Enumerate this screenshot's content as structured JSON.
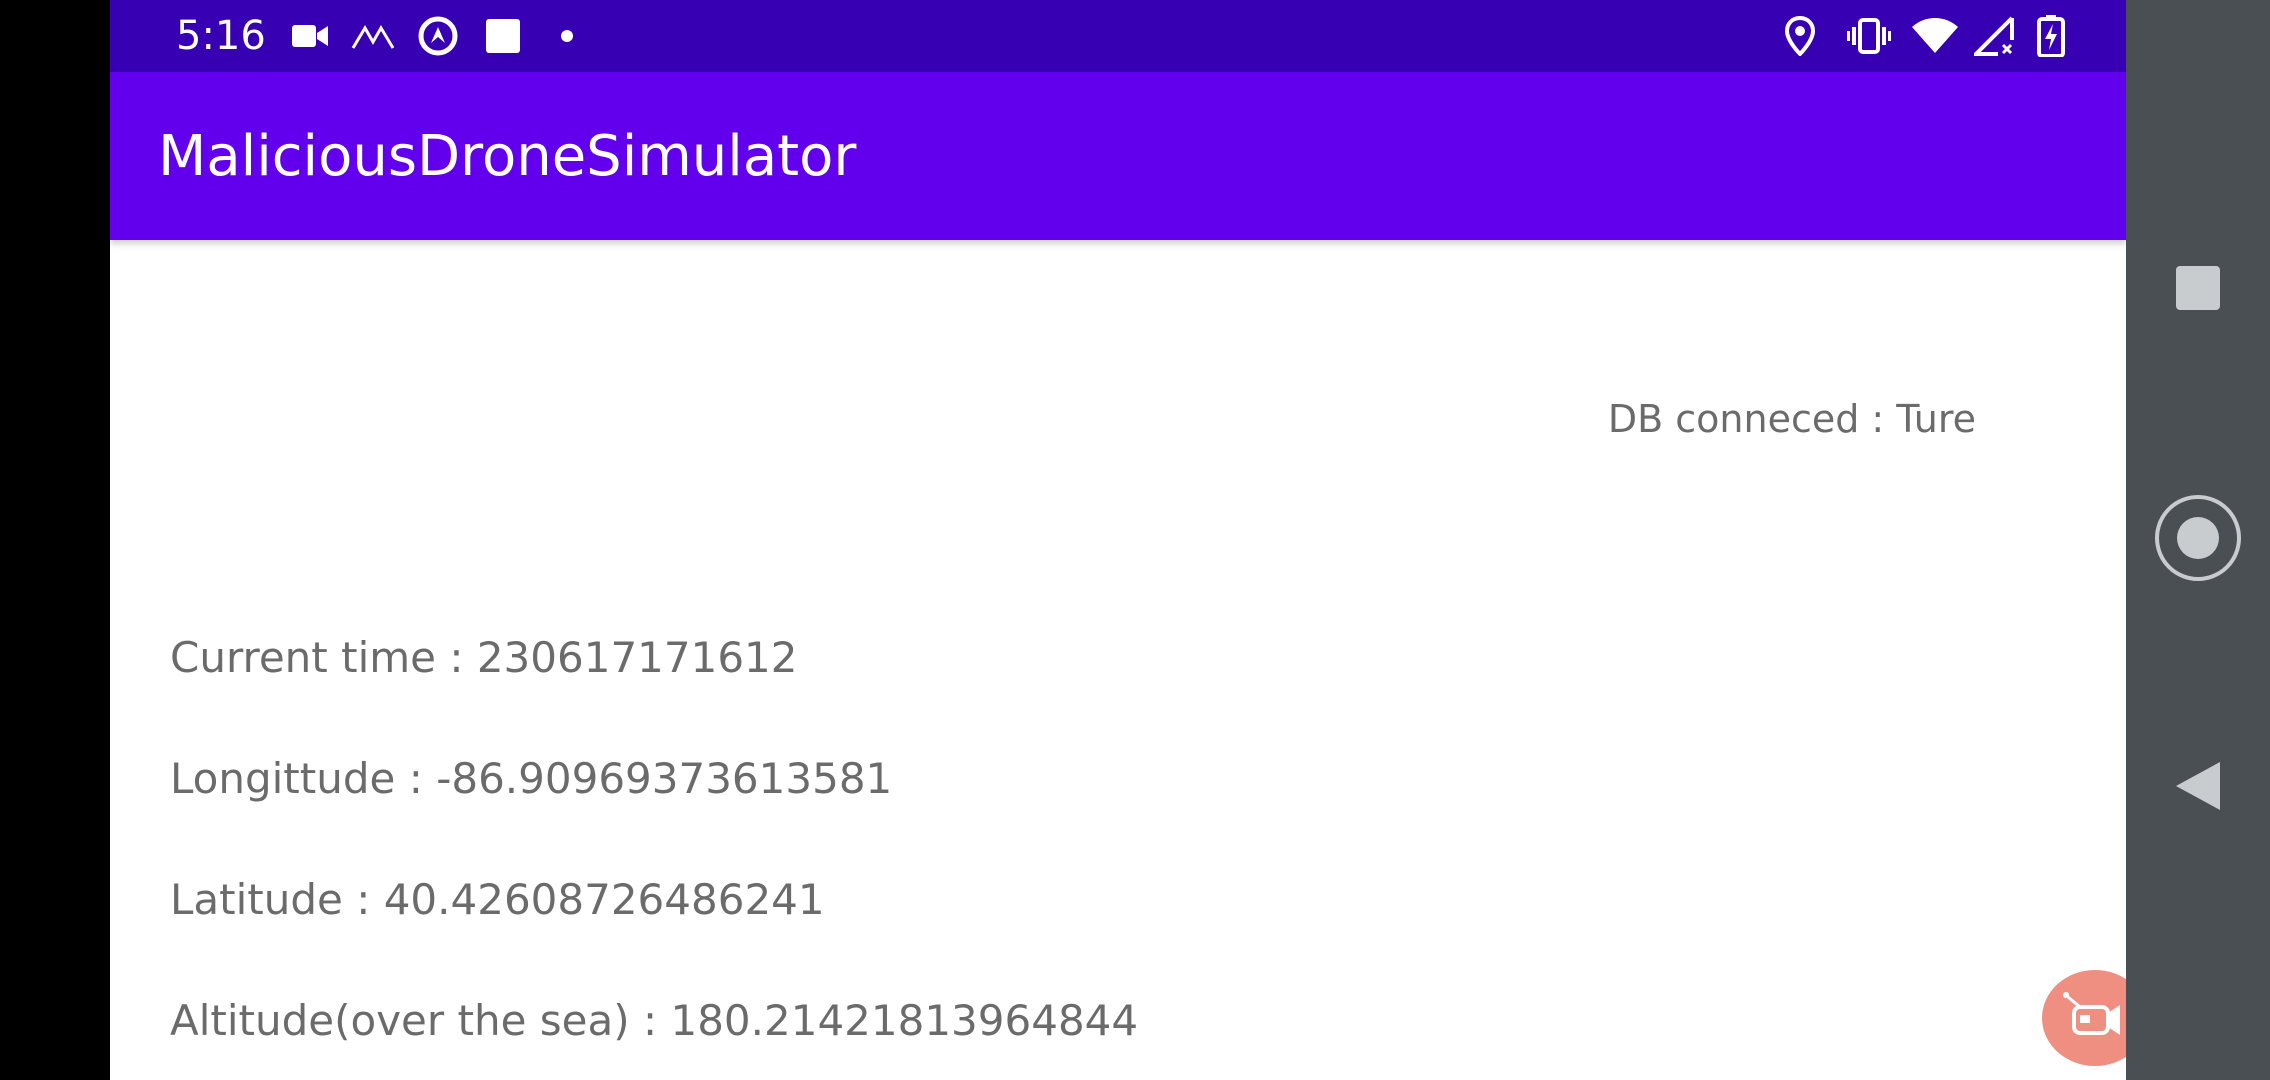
{
  "status_bar": {
    "time": "5:16",
    "left_icons": [
      "video-camera-icon",
      "signal-wave-icon",
      "vpn-circle-icon",
      "square-notification-icon",
      "dot-icon"
    ],
    "right_icons": [
      "location-icon",
      "vibrate-icon",
      "wifi-icon",
      "cellular-no-signal-icon",
      "battery-charging-icon"
    ]
  },
  "app_bar": {
    "title": "MaliciousDroneSimulator"
  },
  "content": {
    "db_status": "DB conneced : Ture",
    "current_time": "Current time : 230617171612",
    "longitude": "Longittude : -86.90969373613581",
    "latitude": "Latitude : 40.42608726486241",
    "altitude": "Altitude(over the sea) : 180.21421813964844"
  },
  "fab": {
    "icon": "drone-controller-icon"
  },
  "navigation": {
    "buttons": [
      "recents-icon",
      "home-icon",
      "back-icon"
    ]
  },
  "colors": {
    "status_bar": "#3700b3",
    "app_bar": "#6200ee",
    "text_gray": "#6b6b6b",
    "fab": "#ef8f82",
    "nav_bar": "#4a4f54"
  }
}
